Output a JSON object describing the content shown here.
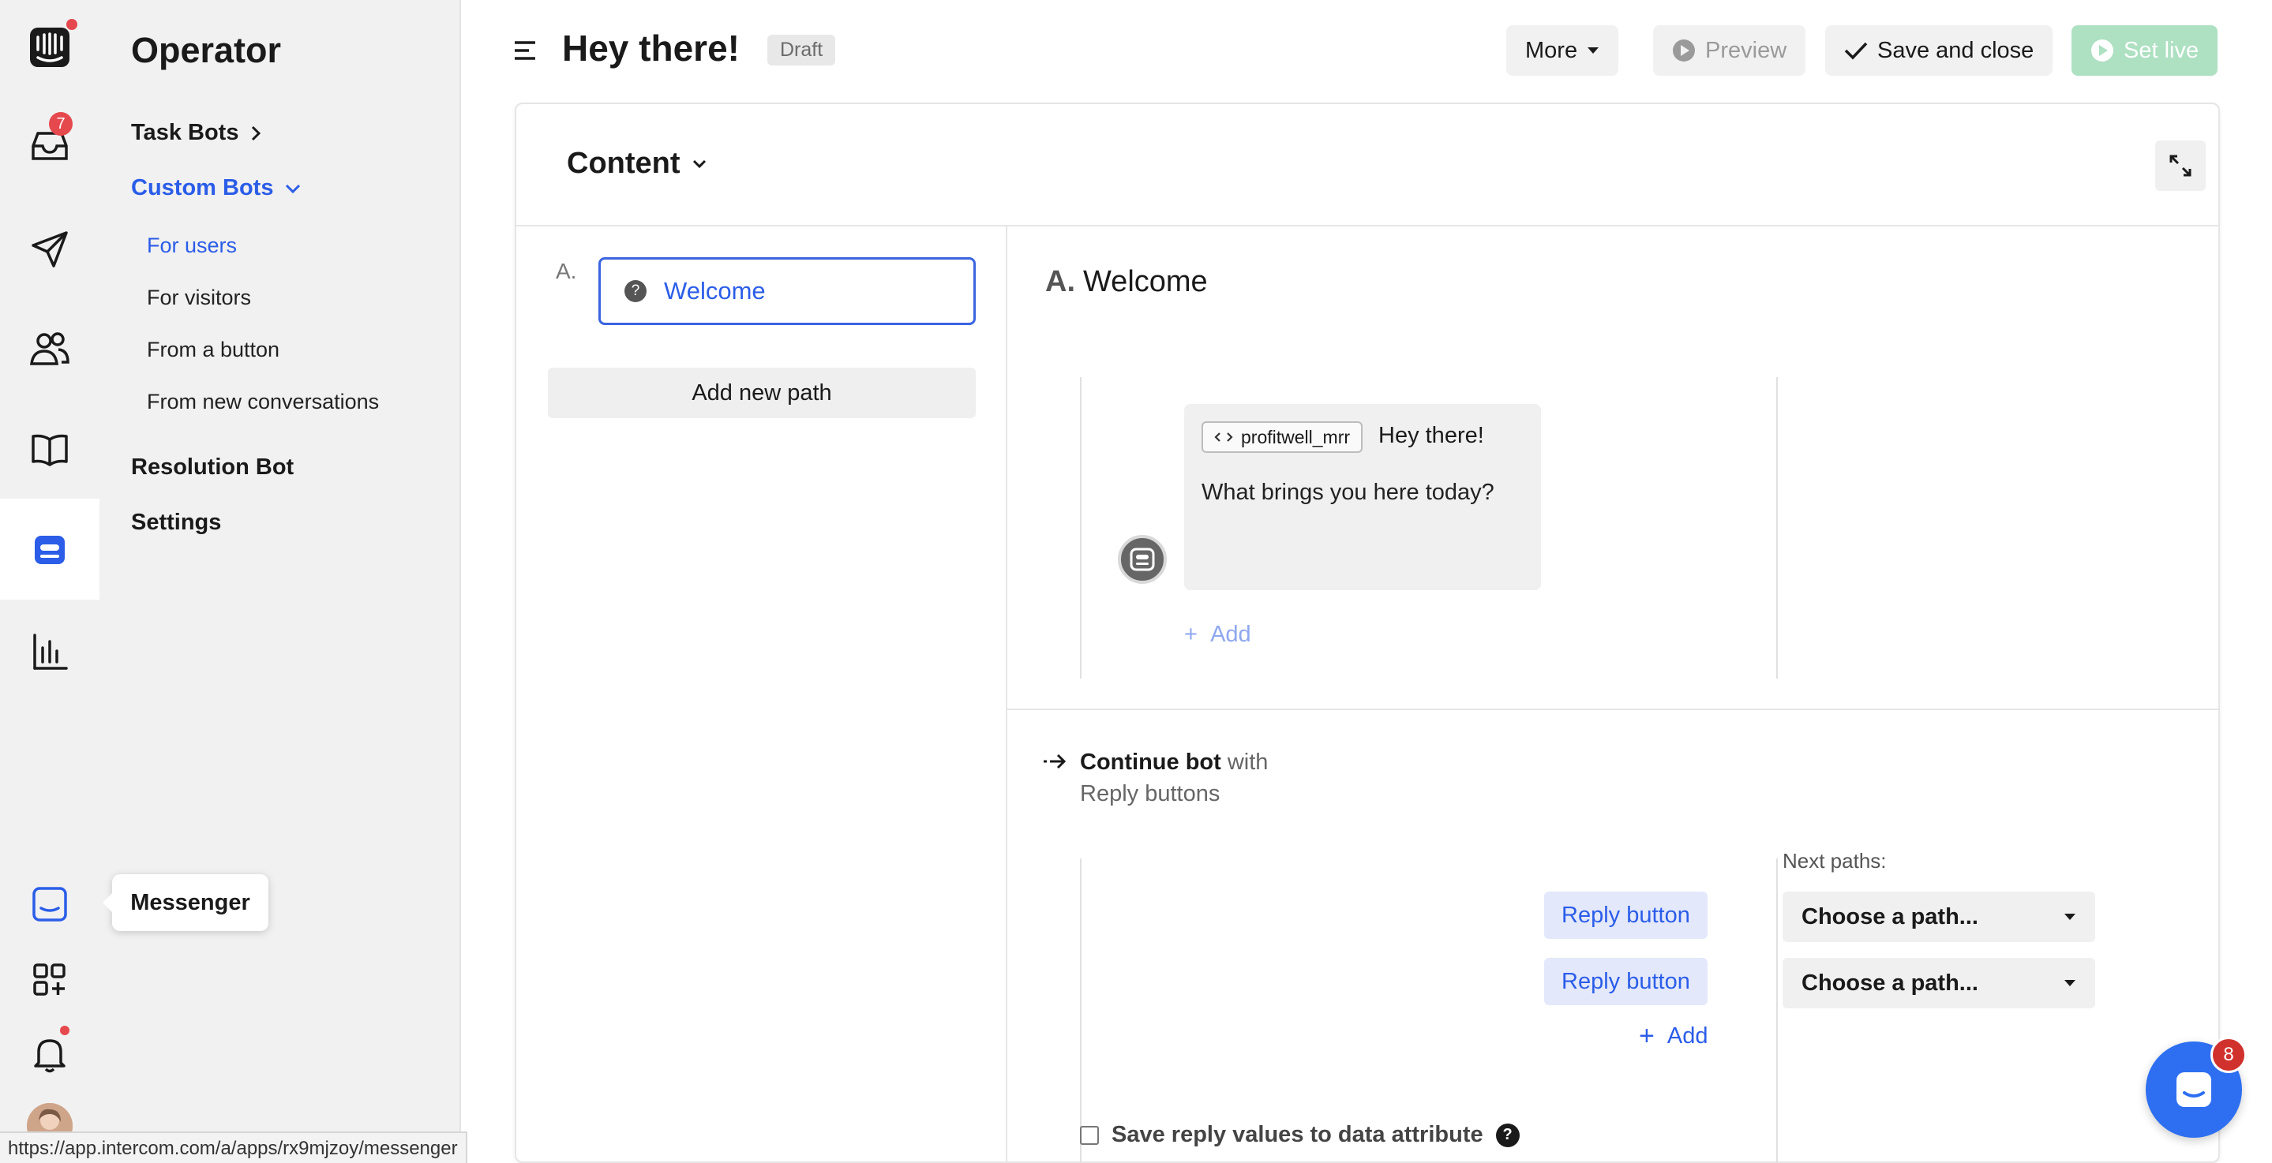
{
  "rail": {
    "inbox_badge": "7",
    "launcher_badge": "8"
  },
  "subnav": {
    "title": "Operator",
    "task_bots": "Task Bots",
    "custom_bots": "Custom Bots",
    "for_users": "For users",
    "for_visitors": "For visitors",
    "from_button": "From a button",
    "from_new_conversations": "From new conversations",
    "resolution_bot": "Resolution Bot",
    "settings": "Settings"
  },
  "tooltip": "Messenger",
  "header": {
    "title": "Hey there!",
    "status": "Draft",
    "more": "More",
    "preview": "Preview",
    "save_close": "Save and close",
    "set_live": "Set live"
  },
  "card": {
    "content_label": "Content",
    "path_letter": "A.",
    "path_name": "Welcome",
    "add_new_path": "Add new path",
    "step_letter": "A.",
    "step_title": "Welcome",
    "attribute_chip": "profitwell_mrr",
    "greeting": "Hey there!",
    "question": "What brings you here today?",
    "msg_add": "Add",
    "continue_bold": "Continue bot",
    "continue_with": "with",
    "continue_type": "Reply buttons",
    "reply_buttons": [
      "Reply button",
      "Reply button"
    ],
    "reply_add": "Add",
    "next_paths_label": "Next paths:",
    "path_selects": [
      "Choose a path...",
      "Choose a path..."
    ],
    "save_attr": "Save reply values to data attribute"
  },
  "status_url": "https://app.intercom.com/a/apps/rx9mjzoy/messenger",
  "colors": {
    "accent": "#2b5de8",
    "set_live": "#aee0c2",
    "badge": "#e5484d"
  }
}
